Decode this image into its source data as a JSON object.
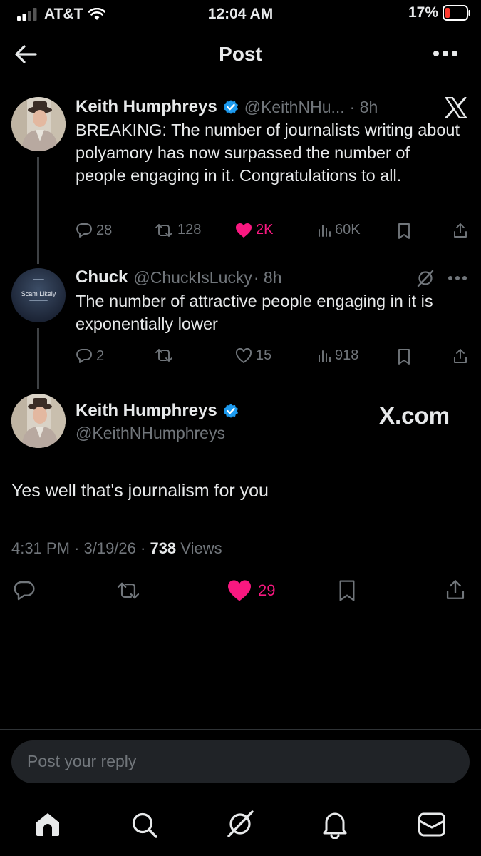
{
  "status_bar": {
    "carrier": "AT&T",
    "time": "12:04 AM",
    "battery": "17%"
  },
  "header": {
    "title": "Post"
  },
  "tweet1": {
    "name": "Keith Humphreys",
    "handle": "@KeithNHu...",
    "time": "· 8h",
    "text": "BREAKING: The number of journalists writing about polyamory has now surpassed the number of people engaging in it. Congratulations to all.",
    "replies": "28",
    "reposts": "128",
    "likes": "2K",
    "views": "60K"
  },
  "tweet2": {
    "name": "Chuck",
    "handle": "@ChuckIsLucky",
    "time": "· 8h",
    "avatar_text": "Scam Likely",
    "text": "The number of attractive people engaging in it is exponentially lower",
    "replies": "2",
    "likes": "15",
    "views": "918"
  },
  "main_tweet": {
    "name": "Keith Humphreys",
    "handle": "@KeithNHumphreys",
    "watermark": "X.com",
    "text": "Yes well that's journalism for you",
    "timestamp": "4:31 PM · 3/19/26 ·",
    "views_count": "738",
    "views_label": "Views",
    "likes": "29"
  },
  "reply": {
    "placeholder": "Post your reply"
  },
  "colors": {
    "background": "#000000",
    "like_pink": "#f91880",
    "verified_blue": "#1d9bf0",
    "muted": "#71767b"
  }
}
